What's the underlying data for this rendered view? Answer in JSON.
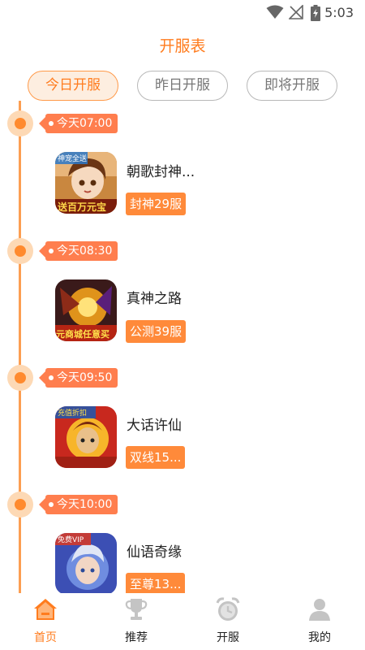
{
  "status_bar": {
    "time": "5:03"
  },
  "page_title": "开服表",
  "tabs": [
    {
      "label": "今日开服",
      "active": true
    },
    {
      "label": "昨日开服",
      "active": false
    },
    {
      "label": "即将开服",
      "active": false
    }
  ],
  "entries": [
    {
      "time": "今天07:00",
      "name": "朝歌封神...",
      "server": "封神29服",
      "icon_text_top": "神宠全送",
      "icon_text_bottom": "送百万元宝"
    },
    {
      "time": "今天08:30",
      "name": "真神之路",
      "server": "公测39服",
      "icon_text_bottom": "元商城任意买"
    },
    {
      "time": "今天09:50",
      "name": "大话许仙",
      "server": "双线15...",
      "icon_text_top": "充值折扣"
    },
    {
      "time": "今天10:00",
      "name": "仙语奇缘",
      "server": "至尊13...",
      "icon_text_top": "免费VIP"
    }
  ],
  "bottom_nav": [
    {
      "label": "首页",
      "icon": "home-icon",
      "active": true
    },
    {
      "label": "推荐",
      "icon": "trophy-icon",
      "active": false
    },
    {
      "label": "开服",
      "icon": "alarm-clock-icon",
      "active": false
    },
    {
      "label": "我的",
      "icon": "user-icon",
      "active": false
    }
  ],
  "colors": {
    "accent": "#ff7c1e",
    "timeline": "#fc9e52",
    "tag": "#ff7e4e",
    "badge": "#ff8a3a",
    "inactive_nav": "#c4c4c4"
  }
}
